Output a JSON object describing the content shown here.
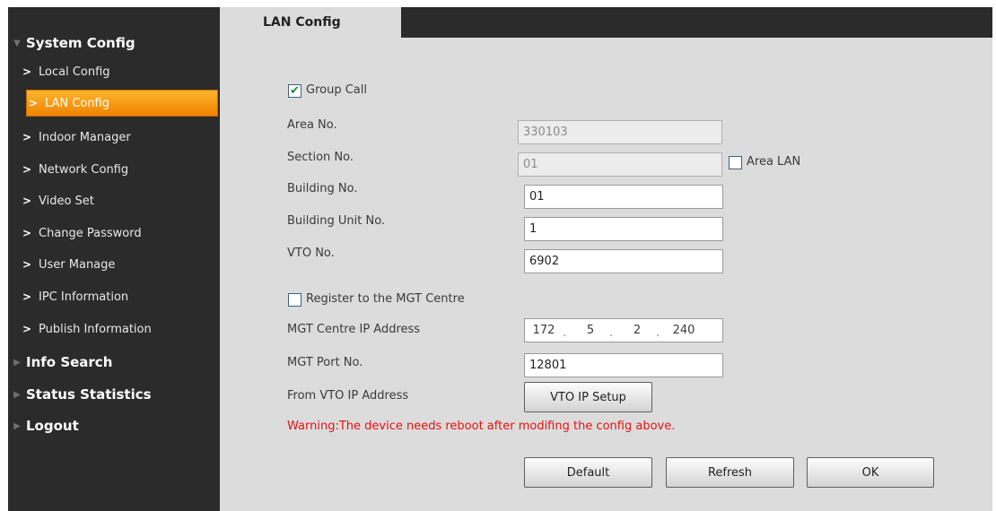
{
  "sidebar": {
    "sections": [
      {
        "label": "System Config",
        "expanded": true
      },
      {
        "label": "Info Search",
        "expanded": false
      },
      {
        "label": "Status Statistics",
        "expanded": false
      },
      {
        "label": "Logout",
        "expanded": false
      }
    ],
    "items": [
      {
        "label": "Local Config"
      },
      {
        "label": "LAN Config",
        "active": true
      },
      {
        "label": "Indoor Manager"
      },
      {
        "label": "Network Config"
      },
      {
        "label": "Video Set"
      },
      {
        "label": "Change Password"
      },
      {
        "label": "User Manage"
      },
      {
        "label": "IPC Information"
      },
      {
        "label": "Publish Information"
      }
    ],
    "arrow_glyph": ">",
    "expanded_glyph": "▼",
    "collapsed_glyph": "▶"
  },
  "tab": {
    "label": "LAN Config"
  },
  "form": {
    "group_call": {
      "label": "Group Call",
      "checked": true
    },
    "area_no": {
      "label": "Area No.",
      "value": "330103",
      "disabled": true
    },
    "section_no": {
      "label": "Section No.",
      "value": "01",
      "disabled": true
    },
    "area_lan": {
      "label": "Area LAN",
      "checked": false
    },
    "building_no": {
      "label": "Building No.",
      "value": "01"
    },
    "building_unit_no": {
      "label": "Building Unit No.",
      "value": "1"
    },
    "vto_no": {
      "label": "VTO No.",
      "value": "6902"
    },
    "register_mgt": {
      "label": "Register to the MGT Centre",
      "checked": false
    },
    "mgt_ip": {
      "label": "MGT Centre IP Address",
      "octets": [
        "172",
        "5",
        "2",
        "240"
      ],
      "separator": "."
    },
    "mgt_port": {
      "label": "MGT Port No.",
      "value": "12801"
    },
    "from_vto_ip": {
      "label": "From VTO IP Address",
      "button": "VTO IP Setup"
    },
    "warning": "Warning:The device needs reboot after modifing the config above."
  },
  "buttons": {
    "default": "Default",
    "refresh": "Refresh",
    "ok": "OK"
  },
  "colors": {
    "sidebar_bg": "#2b2b2b",
    "content_bg": "#dcdcdc",
    "active_item": "#f59a14",
    "warning": "#e81010",
    "check": "#1a8c2a"
  }
}
